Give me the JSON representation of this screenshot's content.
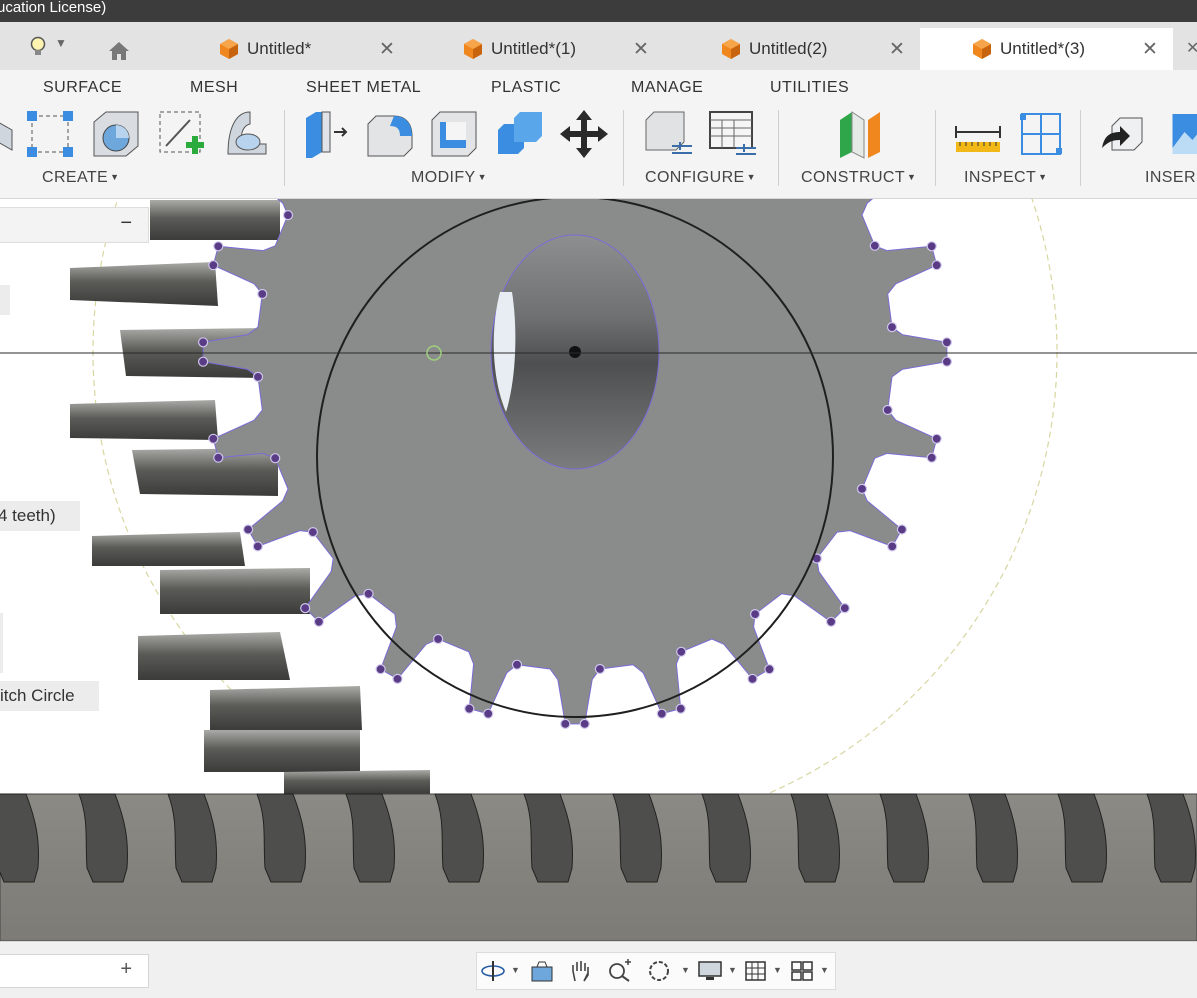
{
  "window": {
    "title_fragment": "ucation License)"
  },
  "tabs": [
    {
      "label": "Untitled*",
      "active": false
    },
    {
      "label": "Untitled*(1)",
      "active": false
    },
    {
      "label": "Untitled(2)",
      "active": false
    },
    {
      "label": "Untitled*(3)",
      "active": true
    }
  ],
  "ribbon": {
    "tabs": [
      "SURFACE",
      "MESH",
      "SHEET METAL",
      "PLASTIC",
      "MANAGE",
      "UTILITIES"
    ],
    "groups": [
      "CREATE",
      "MODIFY",
      "CONFIGURE",
      "CONSTRUCT",
      "INSPECT",
      "INSER"
    ]
  },
  "browser": {
    "item_teeth": "4 teeth)",
    "item_pitch": "itch Circle",
    "collapse_symbol": "−"
  },
  "bottom": {
    "add_symbol": "+"
  },
  "icons": [
    "lightbulb-icon",
    "home-icon",
    "cube-icon",
    "close-icon",
    "orbit-icon",
    "look-at-icon",
    "pan-icon",
    "zoom-icon",
    "fit-icon",
    "display-icon",
    "grid-icon",
    "viewports-icon"
  ],
  "colors": {
    "accent_orange": "#f0861e",
    "sketch_purple": "#5a3c86",
    "gear_gray": "#8a8c8b",
    "tool_blue": "#3a8de0"
  }
}
